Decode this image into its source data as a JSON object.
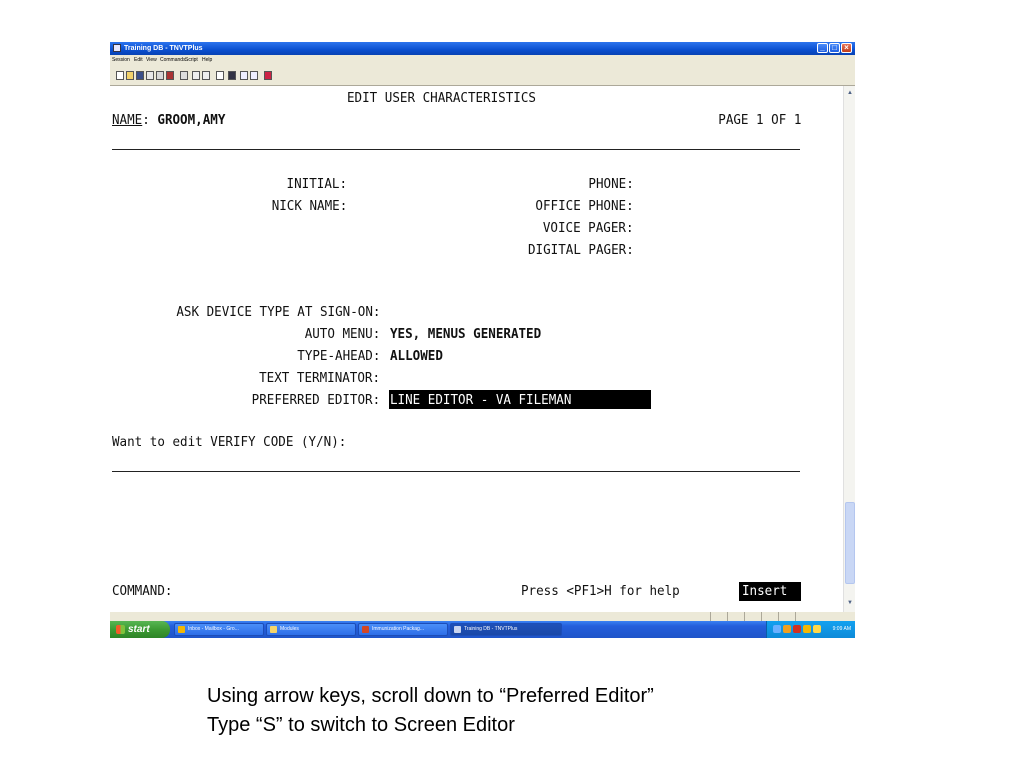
{
  "window": {
    "title": "Training DB - TNVTPlus",
    "menus": [
      "Session",
      "Edit",
      "View",
      "Commands",
      "Script",
      "Help"
    ]
  },
  "terminal": {
    "screen_title": "EDIT USER CHARACTERISTICS",
    "name_label": "NAME",
    "name_sep": ":",
    "name_value": "GROOM,AMY",
    "page_indicator": "PAGE 1 OF 1",
    "initial_label": "INITIAL:",
    "nickname_label": "NICK NAME:",
    "phone_label": "PHONE:",
    "office_phone_label": "OFFICE PHONE:",
    "voice_pager_label": "VOICE PAGER:",
    "digital_pager_label": "DIGITAL PAGER:",
    "ask_device_label": "ASK DEVICE TYPE AT SIGN-ON:",
    "auto_menu_label": "AUTO MENU:",
    "auto_menu_value": "YES, MENUS GENERATED",
    "type_ahead_label": "TYPE-AHEAD:",
    "type_ahead_value": "ALLOWED",
    "text_terminator_label": "TEXT TERMINATOR:",
    "preferred_editor_label": "PREFERRED EDITOR:",
    "preferred_editor_value": "LINE EDITOR - VA FILEMAN",
    "prompt": "Want to edit VERIFY CODE (Y/N):",
    "command_label": "COMMAND:",
    "help_hint": "Press <PF1>H for help",
    "mode_indicator": "Insert"
  },
  "taskbar": {
    "start_label": "start",
    "tasks": [
      {
        "label": "Inbox - Mailbox - Gro...",
        "icon": "outlook-icon",
        "color": "#f2b705"
      },
      {
        "label": "Modules",
        "icon": "folder-icon",
        "color": "#f5d56a"
      },
      {
        "label": "Immunization Packag...",
        "icon": "powerpoint-icon",
        "color": "#d24726"
      },
      {
        "label": "Training DB - TNVTPlus",
        "icon": "terminal-icon",
        "color": "#c8d4f0"
      }
    ],
    "clock": "9:09 AM"
  },
  "caption": {
    "line1": "Using arrow keys, scroll down to “Preferred Editor”",
    "line2": "Type “S” to switch to Screen Editor"
  }
}
